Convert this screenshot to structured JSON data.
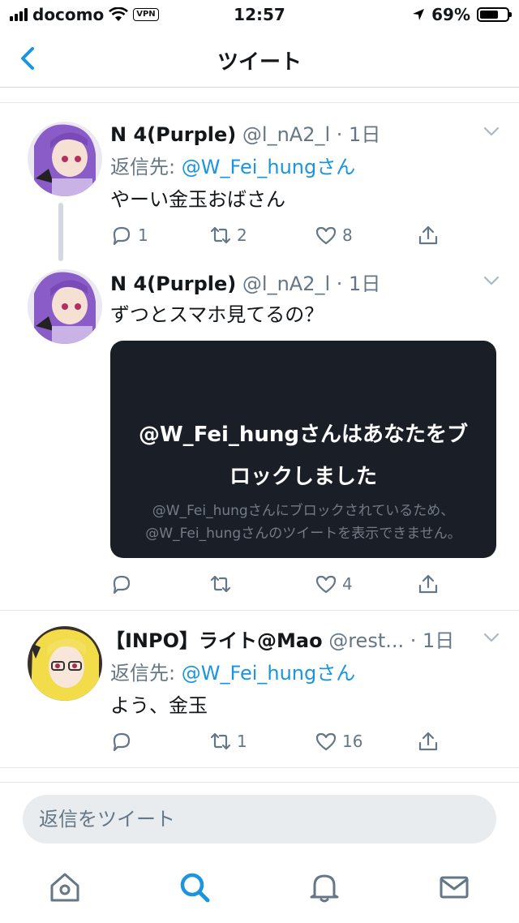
{
  "status_bar": {
    "carrier": "docomo",
    "vpn": "VPN",
    "time": "12:57",
    "battery": "69%",
    "battery_level": 0.69
  },
  "nav": {
    "title": "ツイート"
  },
  "tweets": [
    {
      "name": "N 4(Purple)",
      "handle": "@l_nA2_l",
      "time": "· 1日",
      "reply_label": "返信先: ",
      "reply_to": "@W_Fei_hungさん",
      "text": "やーい金玉おばさん",
      "replies": "1",
      "retweets": "2",
      "likes": "8"
    },
    {
      "name": "N 4(Purple)",
      "handle": "@l_nA2_l",
      "time": "· 1日",
      "text": "ずつとスマホ見てるの？",
      "blocked_title": "@W_Fei_hungさんはあなたをブロックしました",
      "blocked_body": "@W_Fei_hungさんにブロックされているため、@W_Fei_hungさんのツイートを表示できません。",
      "replies": "",
      "retweets": "",
      "likes": "4"
    },
    {
      "name": "【INPO】ライト@Mao",
      "handle": "@rest...",
      "time": "· 1日",
      "reply_label": "返信先: ",
      "reply_to": "@W_Fei_hungさん",
      "text": "よう、金玉",
      "replies": "",
      "retweets": "1",
      "likes": "16"
    }
  ],
  "reply_bar": {
    "placeholder": "返信をツイート"
  },
  "icons": {
    "back": "chevron-left-icon",
    "caret": "chevron-down-icon",
    "reply": "reply-icon",
    "retweet": "retweet-icon",
    "like": "heart-icon",
    "share": "share-icon",
    "home": "home-icon",
    "search": "search-icon",
    "notifications": "bell-icon",
    "messages": "mail-icon"
  },
  "colors": {
    "accent": "#1b95e0",
    "muted": "#657786",
    "card": "#1a1f27"
  }
}
